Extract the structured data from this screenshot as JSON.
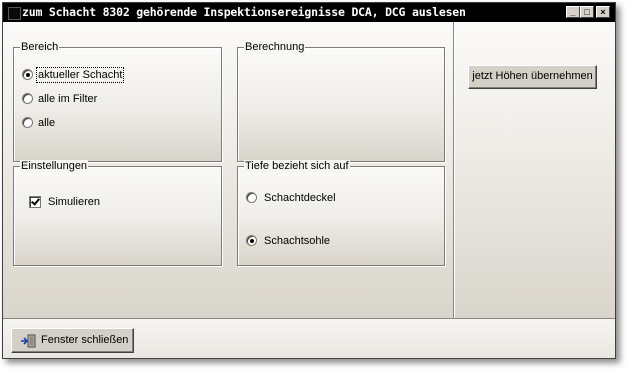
{
  "window": {
    "title": "zum Schacht 8302  gehörende Inspektionsereignisse DCA, DCG auslesen",
    "controls": {
      "minimize": "_",
      "maximize": "□",
      "close": "×"
    }
  },
  "groups": {
    "bereich": {
      "legend": "Bereich",
      "options": [
        {
          "label": "aktueller Schacht",
          "selected": true
        },
        {
          "label": "alle im Filter",
          "selected": false
        },
        {
          "label": "alle",
          "selected": false
        }
      ]
    },
    "berechnung": {
      "legend": "Berechnung"
    },
    "einstellungen": {
      "legend": "Einstellungen",
      "simulieren": {
        "label": "Simulieren",
        "checked": true
      }
    },
    "tiefe": {
      "legend": "Tiefe bezieht sich auf",
      "options": [
        {
          "label": "Schachtdeckel",
          "selected": false
        },
        {
          "label": "Schachtsohle",
          "selected": true
        }
      ]
    }
  },
  "buttons": {
    "apply_heights": "jetzt Höhen übernehmen",
    "close_window": "Fenster schließen"
  },
  "icons": {
    "app": "app-icon",
    "close_window": "door-exit-icon"
  }
}
